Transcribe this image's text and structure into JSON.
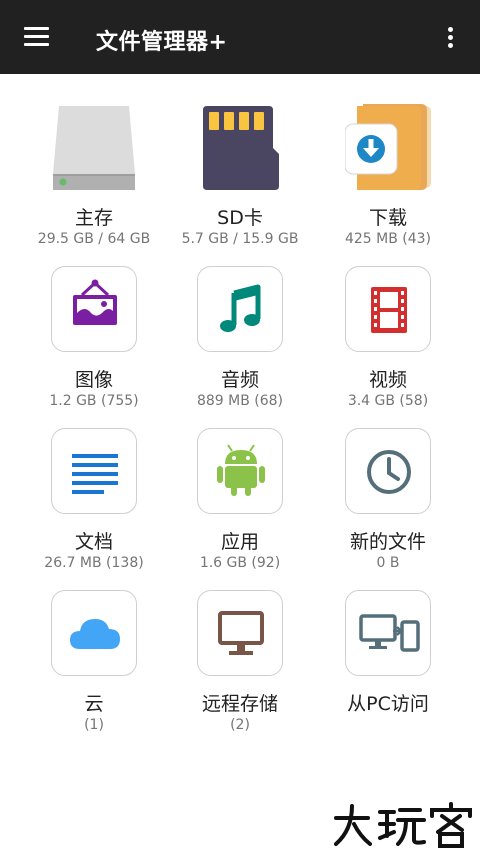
{
  "app_bar": {
    "title": "文件管理器+",
    "menu_icon": "hamburger-menu-icon",
    "overflow_icon": "more-vert-icon"
  },
  "tiles": [
    {
      "label": "主存",
      "sub": "29.5 GB / 64 GB",
      "icon": "hard-drive-icon"
    },
    {
      "label": "SD卡",
      "sub": "5.7 GB / 15.9 GB",
      "icon": "sd-card-icon"
    },
    {
      "label": "下载",
      "sub": "425 MB (43)",
      "icon": "download-folder-icon"
    },
    {
      "label": "图像",
      "sub": "1.2 GB (755)",
      "icon": "image-icon",
      "color": "#7B1FA2"
    },
    {
      "label": "音频",
      "sub": "889 MB (68)",
      "icon": "music-note-icon",
      "color": "#00897B"
    },
    {
      "label": "视频",
      "sub": "3.4 GB (58)",
      "icon": "film-icon",
      "color": "#D32F2F"
    },
    {
      "label": "文档",
      "sub": "26.7 MB (138)",
      "icon": "document-lines-icon",
      "color": "#1976D2"
    },
    {
      "label": "应用",
      "sub": "1.6 GB (92)",
      "icon": "android-icon",
      "color": "#8BC34A"
    },
    {
      "label": "新的文件",
      "sub": "0 B",
      "icon": "clock-icon",
      "color": "#546E7A"
    },
    {
      "label": "云",
      "sub": "(1)",
      "icon": "cloud-icon",
      "color": "#42A5F5"
    },
    {
      "label": "远程存储",
      "sub": "(2)",
      "icon": "monitor-icon",
      "color": "#795548"
    },
    {
      "label": "从PC访问",
      "sub": "",
      "icon": "pc-to-phone-icon",
      "color": "#546E7A"
    }
  ],
  "watermark": "大玩客"
}
